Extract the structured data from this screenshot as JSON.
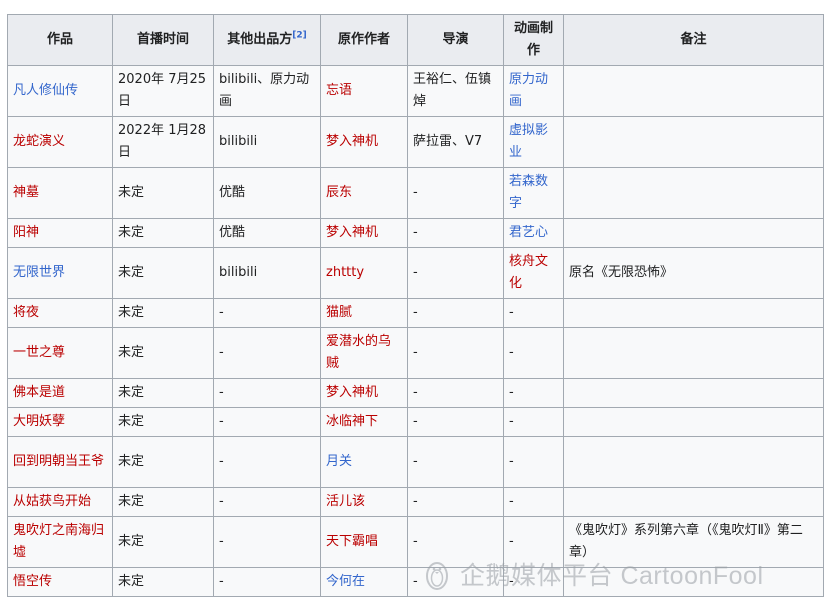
{
  "table": {
    "headers": {
      "work": "作品",
      "premiere": "首播时间",
      "producer": "其他出品方",
      "producer_ref": "[2]",
      "author": "原作作者",
      "director": "导演",
      "studio": "动画制作",
      "note": "备注"
    },
    "rows": [
      {
        "work": "凡人修仙传",
        "premiere": "2020年 7月25日",
        "producer": "bilibili、原力动画",
        "author": "忘语",
        "director": "王裕仁、伍镇焯",
        "studio": "原力动画",
        "note": ""
      },
      {
        "work": "龙蛇演义",
        "premiere": "2022年 1月28日",
        "producer": "bilibili",
        "author": "梦入神机",
        "director": "萨拉雷、V7",
        "studio": "虚拟影业",
        "note": ""
      },
      {
        "work": "神墓",
        "premiere": "未定",
        "producer": "优酷",
        "author": "辰东",
        "director": "-",
        "studio": "若森数字",
        "note": ""
      },
      {
        "work": "阳神",
        "premiere": "未定",
        "producer": "优酷",
        "author": "梦入神机",
        "director": "-",
        "studio": "君艺心",
        "note": ""
      },
      {
        "work": "无限世界",
        "premiere": "未定",
        "producer": "bilibili",
        "author": "zhttty",
        "director": "-",
        "studio": "核舟文化",
        "note": "原名《无限恐怖》"
      },
      {
        "work": "将夜",
        "premiere": "未定",
        "producer": "-",
        "author": "猫腻",
        "director": "-",
        "studio": "-",
        "note": ""
      },
      {
        "work": "一世之尊",
        "premiere": "未定",
        "producer": "-",
        "author": "爱潜水的乌贼",
        "director": "-",
        "studio": "-",
        "note": ""
      },
      {
        "work": "佛本是道",
        "premiere": "未定",
        "producer": "-",
        "author": "梦入神机",
        "director": "-",
        "studio": "-",
        "note": ""
      },
      {
        "work": "大明妖孽",
        "premiere": "未定",
        "producer": "-",
        "author": "冰临神下",
        "director": "-",
        "studio": "-",
        "note": ""
      },
      {
        "work": "回到明朝当王爷",
        "premiere": "未定",
        "producer": "-",
        "author": "月关",
        "director": "-",
        "studio": "-",
        "note": ""
      },
      {
        "work": "从姑获鸟开始",
        "premiere": "未定",
        "producer": "-",
        "author": "活儿该",
        "director": "-",
        "studio": "-",
        "note": ""
      },
      {
        "work": "鬼吹灯之南海归墟",
        "premiere": "未定",
        "producer": "-",
        "author": "天下霸唱",
        "director": "-",
        "studio": "-",
        "note": "《鬼吹灯》系列第六章（《鬼吹灯Ⅱ》第二章）"
      },
      {
        "work": "悟空传",
        "premiere": "未定",
        "producer": "-",
        "author": "今何在",
        "director": "-",
        "studio": "-",
        "note": ""
      }
    ]
  },
  "watermark": {
    "text": "企鹅媒体平台 CartoonFool",
    "icon": "penguin-icon"
  },
  "colors": {
    "link_blue": "#3366cc",
    "link_red": "#ba0000",
    "header_bg": "#eaecf0",
    "cell_bg": "#f8f9fa",
    "border": "#a2a9b1"
  }
}
